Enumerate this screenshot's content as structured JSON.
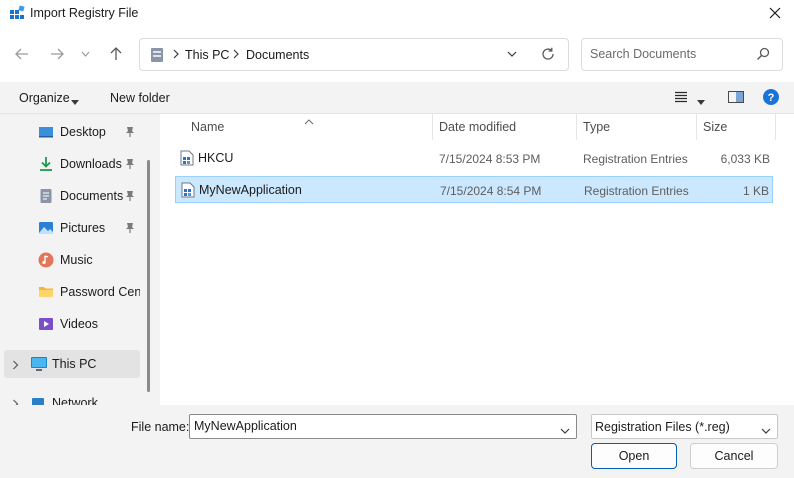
{
  "window": {
    "title": "Import Registry File"
  },
  "navigation": {
    "breadcrumb": [
      "This PC",
      "Documents"
    ],
    "search_placeholder": "Search Documents"
  },
  "toolbar": {
    "organize_label": "Organize",
    "new_folder_label": "New folder"
  },
  "sidebar": {
    "items": [
      {
        "label": "Desktop",
        "icon": "desktop-icon",
        "pinned": true
      },
      {
        "label": "Downloads",
        "icon": "download-icon",
        "pinned": true
      },
      {
        "label": "Documents",
        "icon": "documents-icon",
        "pinned": true
      },
      {
        "label": "Pictures",
        "icon": "pictures-icon",
        "pinned": true
      },
      {
        "label": "Music",
        "icon": "music-icon",
        "pinned": false
      },
      {
        "label": "Password Center",
        "icon": "folder-icon",
        "pinned": false
      },
      {
        "label": "Videos",
        "icon": "videos-icon",
        "pinned": false
      },
      {
        "label": "This PC",
        "icon": "computer-icon",
        "pinned": false
      },
      {
        "label": "Network",
        "icon": "network-icon",
        "pinned": false
      }
    ]
  },
  "file_list": {
    "columns": [
      "Name",
      "Date modified",
      "Type",
      "Size"
    ],
    "rows": [
      {
        "name": "HKCU",
        "date": "7/15/2024 8:53 PM",
        "type": "Registration Entries",
        "size": "6,033 KB",
        "selected": false
      },
      {
        "name": "MyNewApplication",
        "date": "7/15/2024 8:54 PM",
        "type": "Registration Entries",
        "size": "1 KB",
        "selected": true
      }
    ]
  },
  "footer": {
    "file_name_label": "File name:",
    "file_name_value": "MyNewApplication",
    "file_type": "Registration Files (*.reg)",
    "open_label": "Open",
    "cancel_label": "Cancel"
  },
  "colors": {
    "accent": "#005fb8",
    "selection": "#cce8ff",
    "selection_border": "#99d1ff"
  }
}
